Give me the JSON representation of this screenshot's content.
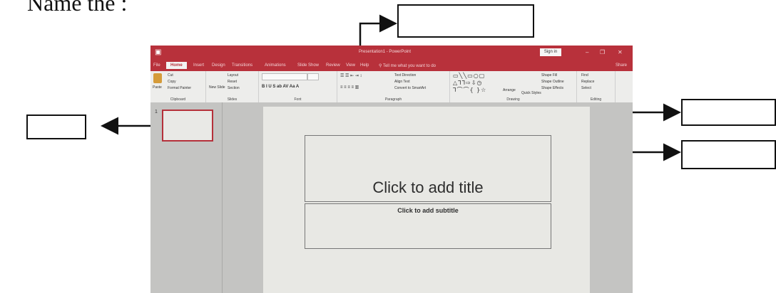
{
  "heading": "Name the :",
  "window": {
    "title": "Presentation1 - PowerPoint",
    "sign_in": "Sign in",
    "minimize": "–",
    "restore": "❐",
    "close": "✕"
  },
  "tabs": [
    "File",
    "Home",
    "Insert",
    "Design",
    "Transitions",
    "Animations",
    "Slide Show",
    "Review",
    "View",
    "Help"
  ],
  "tell_me": "Tell me what you want to do",
  "share": "Share",
  "ribbon": {
    "clipboard": {
      "label": "Clipboard",
      "paste": "Paste",
      "cut": "Cut",
      "copy": "Copy",
      "format_painter": "Format Painter"
    },
    "slides": {
      "label": "Slides",
      "new_slide": "New Slide",
      "layout": "Layout",
      "reset": "Reset",
      "section": "Section"
    },
    "font": {
      "label": "Font"
    },
    "paragraph": {
      "label": "Paragraph",
      "text_direction": "Text Direction",
      "align_text": "Align Text",
      "convert_smartart": "Convert to SmartArt"
    },
    "drawing": {
      "label": "Drawing",
      "arrange": "Arrange",
      "quick_styles": "Quick Styles",
      "shape_fill": "Shape Fill",
      "shape_outline": "Shape Outline",
      "shape_effects": "Shape Effects"
    },
    "editing": {
      "label": "Editing",
      "find": "Find",
      "replace": "Replace",
      "select": "Select"
    }
  },
  "slide_number": "1",
  "slide": {
    "title_placeholder": "Click to add title",
    "subtitle_placeholder": "Click to add subtitle"
  }
}
